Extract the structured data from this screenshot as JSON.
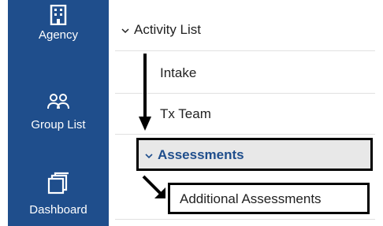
{
  "sidebar": {
    "items": [
      {
        "label": "Agency",
        "icon": "building-icon"
      },
      {
        "label": "Group List",
        "icon": "group-icon"
      },
      {
        "label": "Dashboard",
        "icon": "dashboard-icon"
      }
    ]
  },
  "tree": {
    "parent_label": "Activity List",
    "items": [
      {
        "label": "Intake"
      },
      {
        "label": "Tx Team"
      },
      {
        "label": "Assessments"
      },
      {
        "label": "Additional Assessments"
      }
    ]
  },
  "colors": {
    "sidebar_bg": "#1f4e8c",
    "selected_text": "#1f4e8c",
    "highlight_bg": "#e8e8e8"
  }
}
